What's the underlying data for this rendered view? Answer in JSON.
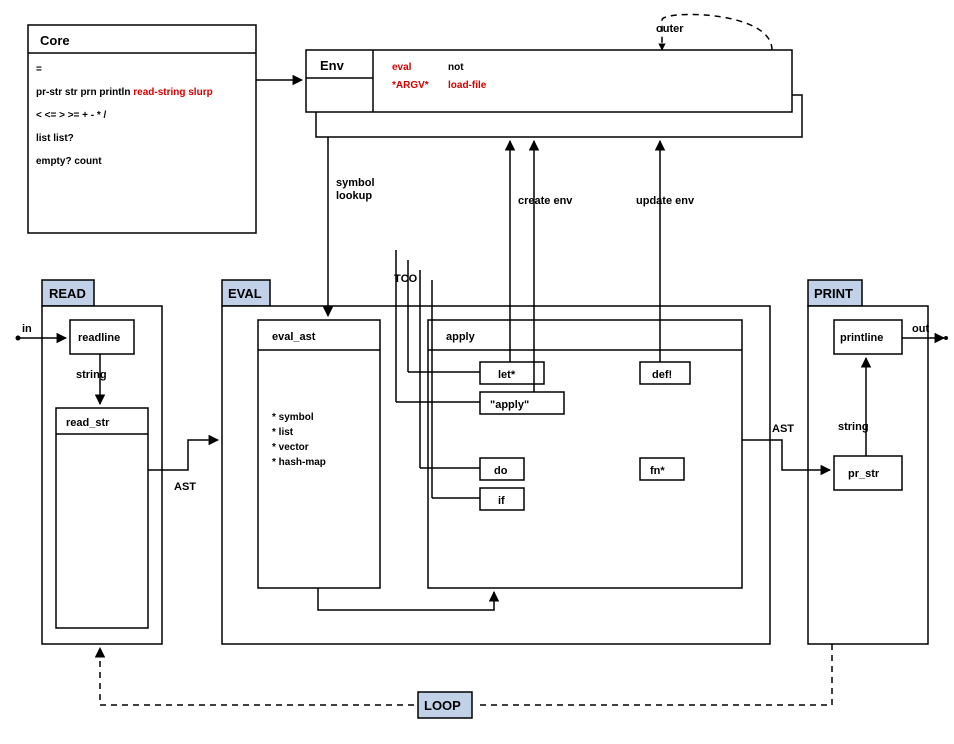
{
  "core": {
    "title": "Core",
    "l1": "=",
    "l2a": "pr-str str prn println ",
    "l2b": "read-string slurp",
    "l3": "< <= > >= + - * /",
    "l4": "list list?",
    "l5": "empty? count"
  },
  "env": {
    "title": "Env",
    "r1": "eval",
    "r2": "*ARGV*",
    "b1": "not",
    "b2": "load-file",
    "outer": "outer"
  },
  "stages": {
    "read": "READ",
    "eval": "EVAL",
    "print": "PRINT",
    "loop": "LOOP"
  },
  "read": {
    "readline": "readline",
    "read_str": "read_str",
    "string": "string"
  },
  "eval": {
    "eval_ast": "eval_ast",
    "apply": "apply",
    "let": "let*",
    "applyq": "\"apply\"",
    "do": "do",
    "if": "if",
    "fn": "fn*",
    "def": "def!",
    "bul1": "* symbol",
    "bul2": "* list",
    "bul3": "* vector",
    "bul4": "* hash-map",
    "tco": "TCO"
  },
  "print": {
    "printline": "printline",
    "pr_str": "pr_str",
    "string": "string"
  },
  "io": {
    "in": "in",
    "out": "out"
  },
  "edges": {
    "symbol_lookup": "symbol\nlookup",
    "create_env": "create env",
    "update_env": "update env",
    "ast1": "AST",
    "ast2": "AST"
  }
}
